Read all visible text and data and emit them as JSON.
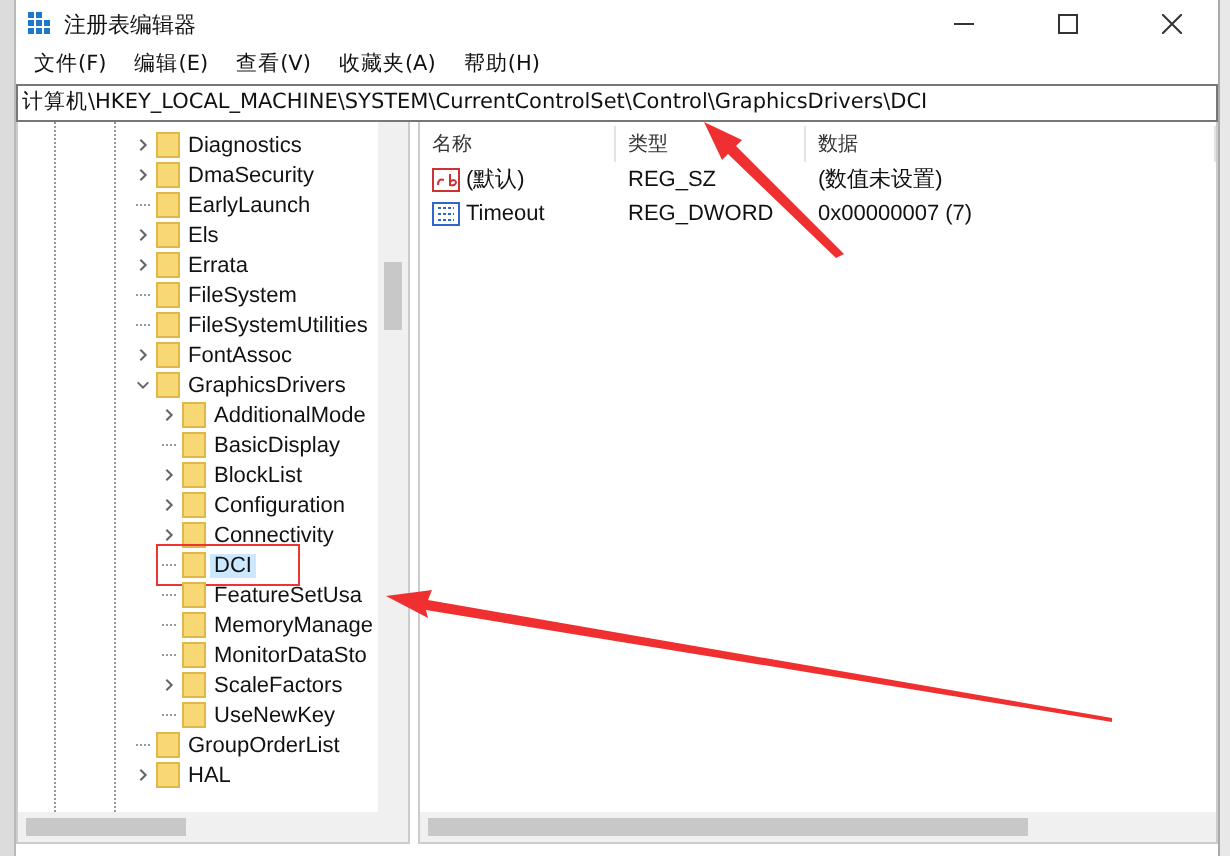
{
  "window": {
    "title": "注册表编辑器"
  },
  "menu": [
    {
      "label": "文件(F)"
    },
    {
      "label": "编辑(E)"
    },
    {
      "label": "查看(V)"
    },
    {
      "label": "收藏夹(A)"
    },
    {
      "label": "帮助(H)"
    }
  ],
  "address": "计算机\\HKEY_LOCAL_MACHINE\\SYSTEM\\CurrentControlSet\\Control\\GraphicsDrivers\\DCI",
  "tree": [
    {
      "label": "Diagnostics",
      "expandable": true,
      "expanded": false,
      "selected": false
    },
    {
      "label": "DmaSecurity",
      "expandable": true,
      "expanded": false,
      "selected": false
    },
    {
      "label": "EarlyLaunch",
      "expandable": false,
      "selected": false
    },
    {
      "label": "Els",
      "expandable": true,
      "expanded": false,
      "selected": false
    },
    {
      "label": "Errata",
      "expandable": true,
      "expanded": false,
      "selected": false
    },
    {
      "label": "FileSystem",
      "expandable": false,
      "selected": false
    },
    {
      "label": "FileSystemUtilities",
      "expandable": false,
      "selected": false
    },
    {
      "label": "FontAssoc",
      "expandable": true,
      "expanded": false,
      "selected": false
    },
    {
      "label": "GraphicsDrivers",
      "expandable": true,
      "expanded": true,
      "selected": false,
      "children": [
        {
          "label": "AdditionalMode",
          "expandable": true,
          "expanded": false,
          "selected": false
        },
        {
          "label": "BasicDisplay",
          "expandable": false,
          "selected": false
        },
        {
          "label": "BlockList",
          "expandable": true,
          "expanded": false,
          "selected": false
        },
        {
          "label": "Configuration",
          "expandable": true,
          "expanded": false,
          "selected": false
        },
        {
          "label": "Connectivity",
          "expandable": true,
          "expanded": false,
          "selected": false
        },
        {
          "label": "DCI",
          "expandable": false,
          "selected": true
        },
        {
          "label": "FeatureSetUsa",
          "expandable": false,
          "selected": false
        },
        {
          "label": "MemoryManage",
          "expandable": false,
          "selected": false
        },
        {
          "label": "MonitorDataSto",
          "expandable": false,
          "selected": false
        },
        {
          "label": "ScaleFactors",
          "expandable": true,
          "expanded": false,
          "selected": false
        },
        {
          "label": "UseNewKey",
          "expandable": false,
          "selected": false
        }
      ]
    },
    {
      "label": "GroupOrderList",
      "expandable": false,
      "selected": false
    },
    {
      "label": "HAL",
      "expandable": true,
      "expanded": false,
      "selected": false
    }
  ],
  "values": {
    "columns": [
      "名称",
      "类型",
      "数据"
    ],
    "rows": [
      {
        "kind": "string",
        "name": "(默认)",
        "type": "REG_SZ",
        "data": "(数值未设置)"
      },
      {
        "kind": "dword",
        "name": "Timeout",
        "type": "REG_DWORD",
        "data": "0x00000007 (7)"
      }
    ]
  }
}
